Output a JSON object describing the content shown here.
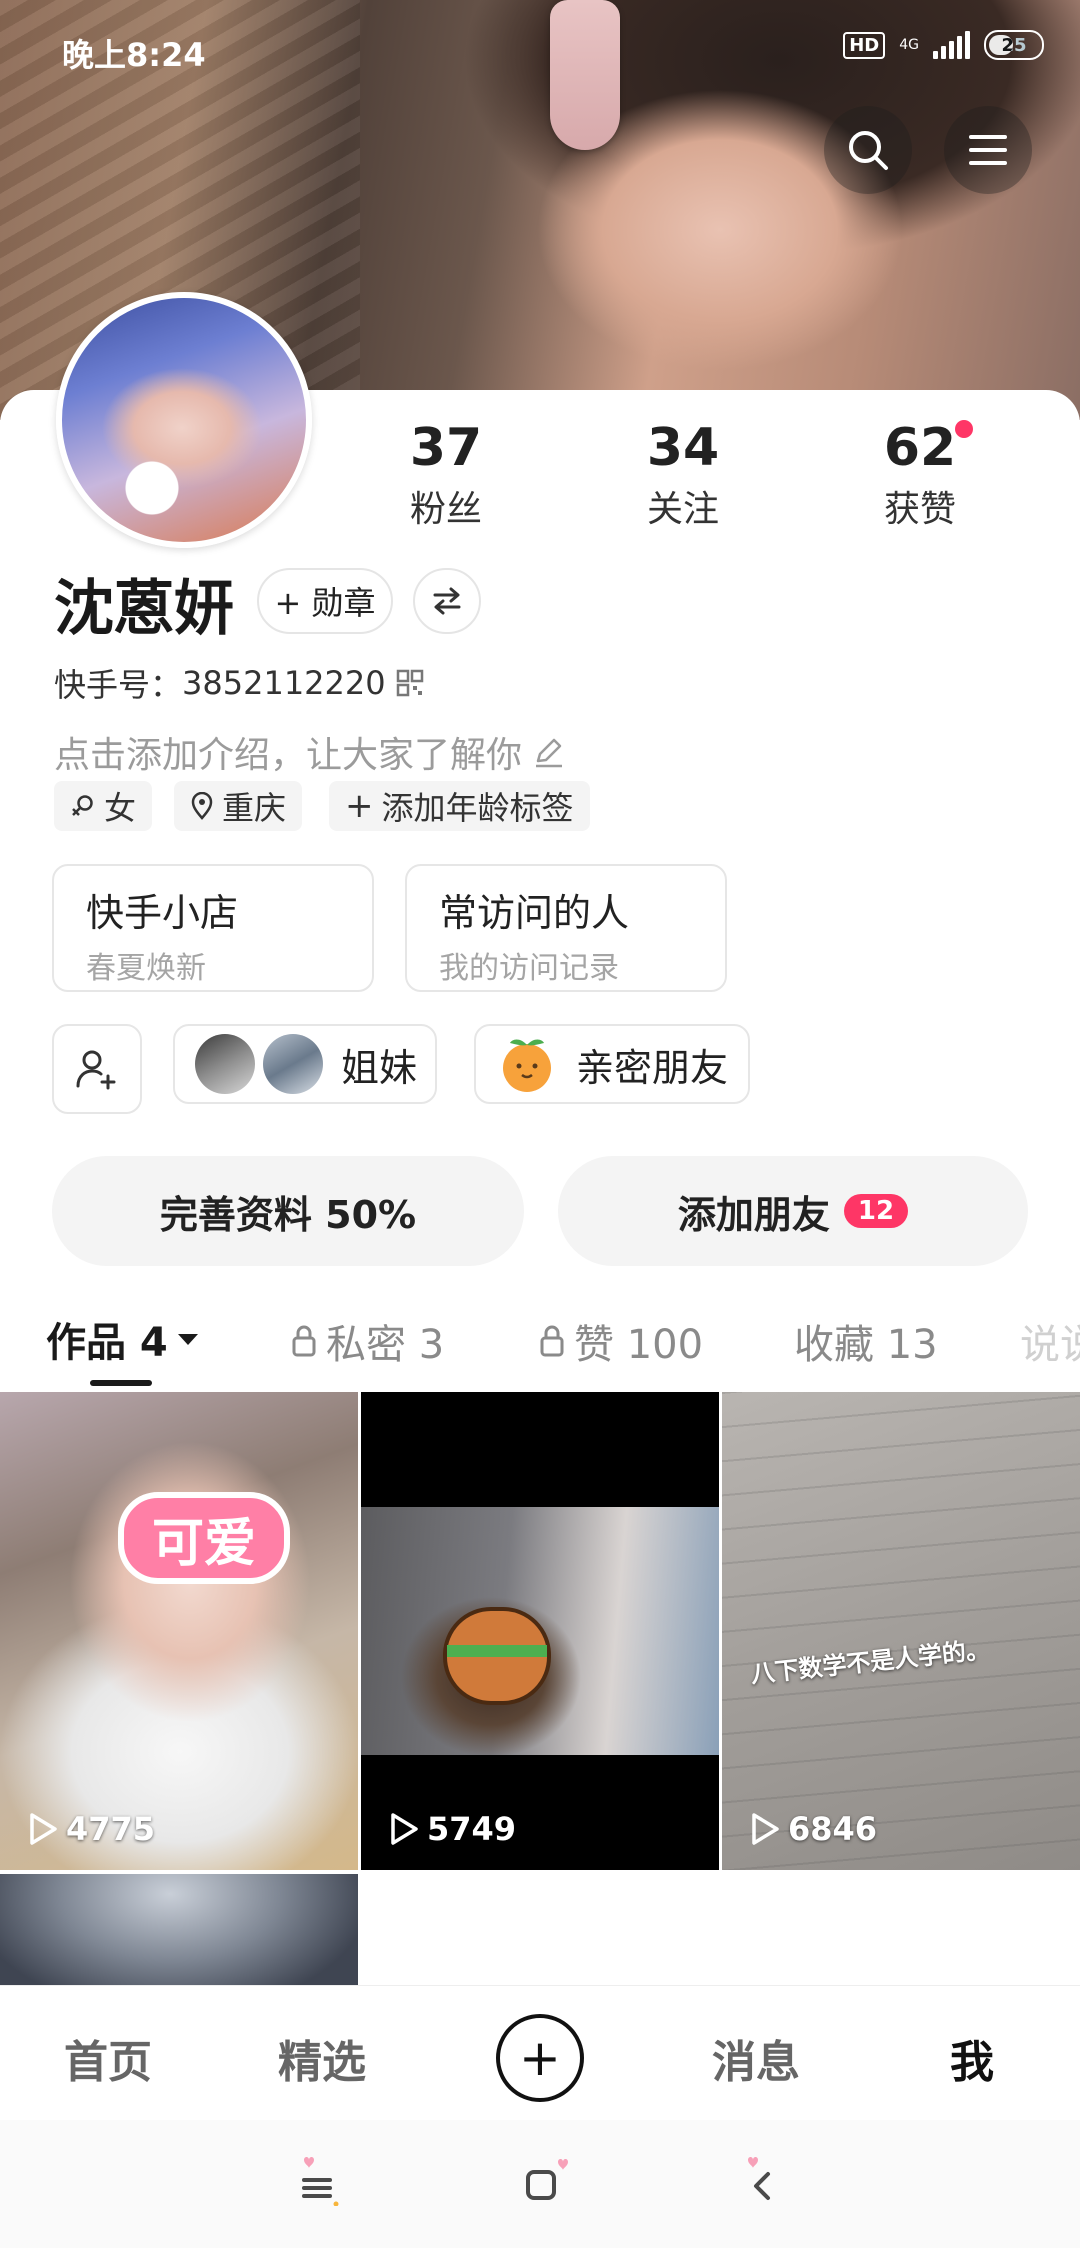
{
  "status_bar": {
    "time": "晚上8:24",
    "hd": "HD",
    "network": "4G",
    "battery": "25"
  },
  "header": {
    "search_icon": "search-icon",
    "menu_icon": "menu-icon"
  },
  "profile": {
    "stats": [
      {
        "num": "37",
        "label": "粉丝"
      },
      {
        "num": "34",
        "label": "关注"
      },
      {
        "num": "62",
        "label": "获赞"
      }
    ],
    "name": "沈蒽妍",
    "medal_button": "+ 勋章",
    "kuaishou_id_label": "快手号：",
    "kuaishou_id": "3852112220",
    "intro_placeholder": "点击添加介绍，让大家了解你",
    "tags": {
      "gender": "女",
      "location": "重庆",
      "age": "添加年龄标签"
    }
  },
  "cards": [
    {
      "title": "快手小店",
      "subtitle": "春夏焕新"
    },
    {
      "title": "常访问的人",
      "subtitle": "我的访问记录"
    }
  ],
  "chips": {
    "sisters": "姐妹",
    "close_friends": "亲密朋友"
  },
  "actions": {
    "complete_profile": "完善资料 50%",
    "add_friends": "添加朋友",
    "add_friends_badge": "12"
  },
  "tabs": [
    {
      "label": "作品 4",
      "active": true
    },
    {
      "label": "私密 3",
      "active": false
    },
    {
      "label": "赞 100",
      "active": false
    },
    {
      "label": "收藏 13",
      "active": false
    },
    {
      "label": "说说",
      "active": false
    }
  ],
  "videos": [
    {
      "plays": "4775",
      "sticker": "可爱"
    },
    {
      "plays": "5749"
    },
    {
      "plays": "6846",
      "caption": "八下数学不是人学的。"
    }
  ],
  "bottom_nav": [
    {
      "label": "首页"
    },
    {
      "label": "精选"
    },
    {
      "label": "+"
    },
    {
      "label": "消息"
    },
    {
      "label": "我"
    }
  ],
  "colors": {
    "accent": "#fe3666",
    "pill_bg": "#f4f4f4",
    "text_gray": "#9b9b9b"
  }
}
